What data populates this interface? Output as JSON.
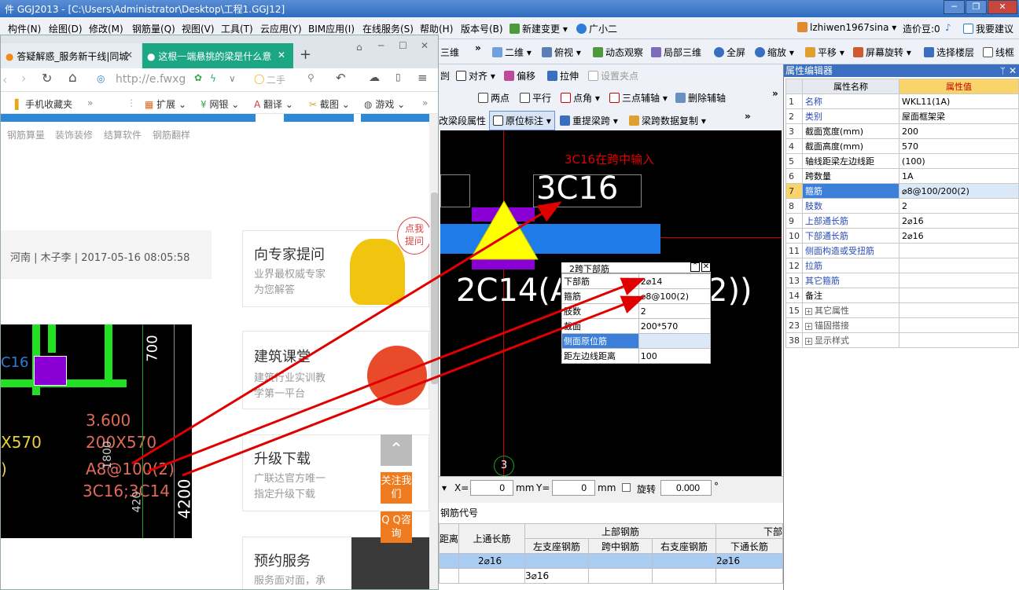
{
  "window": {
    "title": "件 GGJ2013 - [C:\\Users\\Administrator\\Desktop\\工程1.GGJ12]",
    "min": "─",
    "max": "❐",
    "close": "✕"
  },
  "menu": {
    "items": [
      "构件(N)",
      "绘图(D)",
      "修改(M)",
      "钢筋量(Q)",
      "视图(V)",
      "工具(T)",
      "云应用(Y)",
      "BIM应用(I)",
      "在线服务(S)",
      "帮助(H)",
      "版本号(B)",
      "新建变更",
      "广小二"
    ],
    "user": "lzhiwen1967sina",
    "coins": "造价豆:0",
    "suggest": "我要建议"
  },
  "toolbar1": [
    "三维",
    "二维",
    "俯视",
    "动态观察",
    "局部三维",
    "全屏",
    "缩放",
    "平移",
    "屏幕旋转",
    "选择楼层",
    "线框"
  ],
  "toolbar2": [
    "对齐",
    "偏移",
    "拉伸",
    "设置夹点"
  ],
  "toolbar2_left": "剀",
  "toolbar3": [
    "两点",
    "平行",
    "点角",
    "三点辅轴",
    "删除辅轴"
  ],
  "toolbar4": [
    "改梁段属性",
    "原位标注",
    "重提梁跨",
    "梁跨数据复制"
  ],
  "canvas": {
    "hint": "3C16在跨中输入",
    "big_label": "3C16",
    "bottom_label": "2C14(A",
    "bottom_label_tail": "2))",
    "axis_label": "3"
  },
  "popup": {
    "title": "2跨下部筋",
    "rows": [
      {
        "name": "下部筋",
        "value": "2⌀14"
      },
      {
        "name": "箍筋",
        "value": "⌀8@100(2)"
      },
      {
        "name": "肢数",
        "value": "2"
      },
      {
        "name": "截面",
        "value": "200*570"
      },
      {
        "name": "侧面原位筋",
        "value": ""
      },
      {
        "name": "距左边线距离",
        "value": "100"
      }
    ]
  },
  "coord": {
    "x_label": "X=",
    "x_val": "0",
    "unit": "mm",
    "y_label": "Y=",
    "y_val": "0",
    "rotate": "旋转",
    "rotate_val": "0.000",
    "deg": "°"
  },
  "rebar_table": {
    "title": "钢筋代号",
    "h_top": "上部钢筋",
    "h_bottom": "下部",
    "h_dist": "距离",
    "h_through": "上通长筋",
    "cols": [
      "左支座钢筋",
      "跨中钢筋",
      "右支座钢筋",
      "下通长筋"
    ],
    "row1": [
      "2⌀16",
      "2⌀16"
    ],
    "row2": [
      "3⌀16"
    ]
  },
  "browser": {
    "tab1": "答疑解惑_服务新干线|同城",
    "tab2": "这根一端悬挑的梁是什么意",
    "url": "http://e.fwxg",
    "search": "二手",
    "bookmarks": [
      "手机收藏夹",
      "扩展",
      "网银",
      "翻译",
      "截图",
      "游戏"
    ],
    "nav": [
      "钢筋算量",
      "装饰装修",
      "结算软件",
      "钢筋翻样"
    ],
    "meta": "河南 | 木子李 | 2017-05-16 08:05:58",
    "image_texts": {
      "c16": "C16",
      "dim700": "700",
      "elev": "3.600",
      "sec1": "200X570",
      "sec2": "X570",
      "stir": "A8@100(2)",
      "rebar": "3C16;3C14",
      "d1800": "1800",
      "d420": "420",
      "d4200": "4200",
      "paren": ")"
    }
  },
  "cards": [
    {
      "title": "向专家提问",
      "sub1": "业界最权威专家",
      "sub2": "为您解答",
      "bubble": "点我提问"
    },
    {
      "title": "建筑课堂",
      "sub1": "建筑行业实训教",
      "sub2": "学第一平台"
    },
    {
      "title": "升级下载",
      "sub1": "广联达官方唯一",
      "sub2": "指定升级下载"
    },
    {
      "title": "预约服务",
      "sub1": "服务面对面，承"
    }
  ],
  "float_buttons": {
    "follow": "关注我们",
    "qq": "Q Q咨询"
  },
  "property_editor": {
    "title": "属性编辑器",
    "h_name": "属性名称",
    "h_value": "属性值",
    "rows": [
      {
        "n": "1",
        "name": "名称",
        "value": "WKL11(1A)"
      },
      {
        "n": "2",
        "name": "类别",
        "value": "屋面框架梁"
      },
      {
        "n": "3",
        "name": "截面宽度(mm)",
        "value": "200"
      },
      {
        "n": "4",
        "name": "截面高度(mm)",
        "value": "570"
      },
      {
        "n": "5",
        "name": "轴线距梁左边线距",
        "value": "(100)"
      },
      {
        "n": "6",
        "name": "跨数量",
        "value": "1A"
      },
      {
        "n": "7",
        "name": "箍筋",
        "value": "⌀8@100/200(2)"
      },
      {
        "n": "8",
        "name": "肢数",
        "value": "2"
      },
      {
        "n": "9",
        "name": "上部通长筋",
        "value": "2⌀16"
      },
      {
        "n": "10",
        "name": "下部通长筋",
        "value": "2⌀16"
      },
      {
        "n": "11",
        "name": "侧面构造或受扭筋",
        "value": ""
      },
      {
        "n": "12",
        "name": "拉筋",
        "value": ""
      },
      {
        "n": "13",
        "name": "其它箍筋",
        "value": ""
      },
      {
        "n": "14",
        "name": "备注",
        "value": ""
      },
      {
        "n": "15",
        "name": "其它属性",
        "value": ""
      },
      {
        "n": "23",
        "name": "锚固搭接",
        "value": ""
      },
      {
        "n": "38",
        "name": "显示样式",
        "value": ""
      }
    ]
  },
  "colors": {
    "accent": "#3b6fbf",
    "arrow": "#e00000",
    "rebar_purple": "#8a00d4",
    "beam_blue": "#1e7be8",
    "highlight": "#f8d46a"
  }
}
